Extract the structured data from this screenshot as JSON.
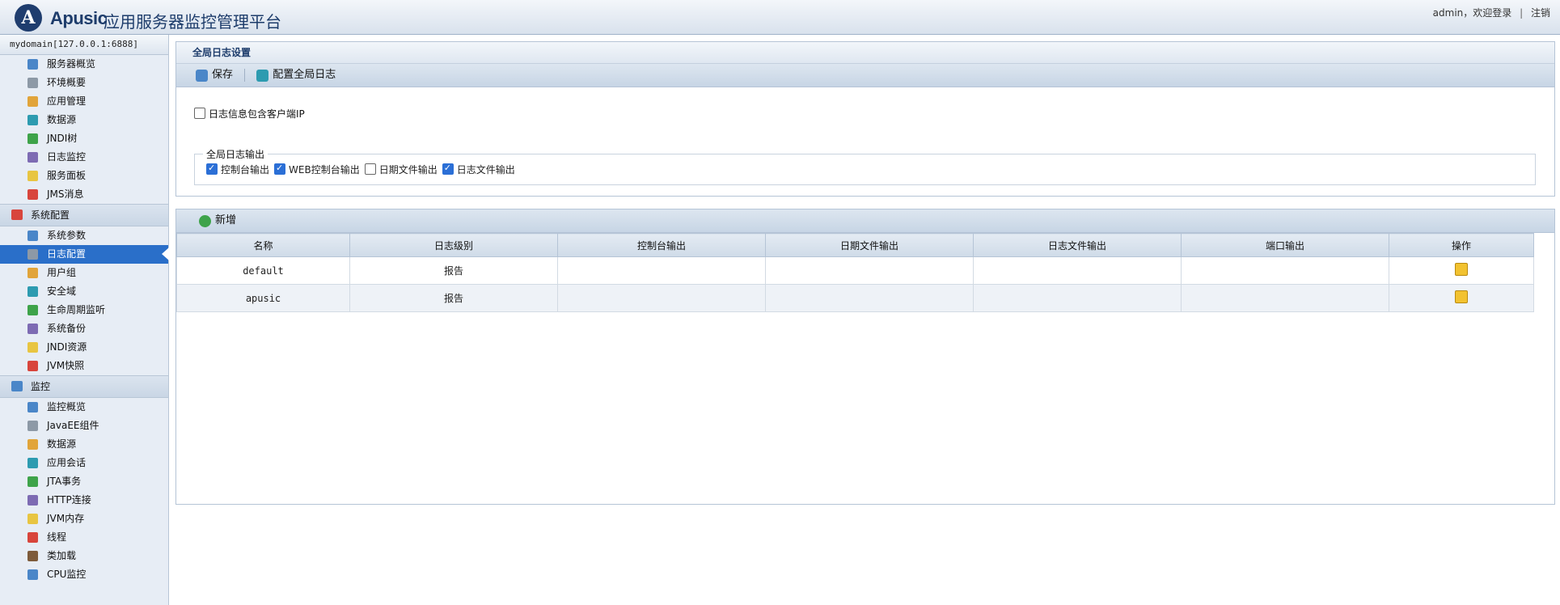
{
  "header": {
    "logo_letter": "A",
    "brand": "Apusic",
    "title": "应用服务器监控管理平台",
    "user_text": "admin，欢迎登录",
    "separator": "|",
    "logout": "注销"
  },
  "sidebar": {
    "domain": "mydomain[127.0.0.1:6888]",
    "overview_items": [
      {
        "label": "服务器概览",
        "icon": "server-overview-icon"
      },
      {
        "label": "环境概要",
        "icon": "environment-icon"
      },
      {
        "label": "应用管理",
        "icon": "application-icon"
      },
      {
        "label": "数据源",
        "icon": "database-icon"
      },
      {
        "label": "JNDI树",
        "icon": "jndi-tree-icon"
      },
      {
        "label": "日志监控",
        "icon": "monitor-icon"
      },
      {
        "label": "服务面板",
        "icon": "service-panel-icon"
      },
      {
        "label": "JMS消息",
        "icon": "jms-icon"
      }
    ],
    "config_section": "系统配置",
    "config_items": [
      {
        "label": "系统参数",
        "icon": "parameters-icon"
      },
      {
        "label": "日志配置",
        "icon": "log-config-icon",
        "active": true
      },
      {
        "label": "用户组",
        "icon": "users-icon"
      },
      {
        "label": "安全域",
        "icon": "security-icon"
      },
      {
        "label": "生命周期监听",
        "icon": "lifecycle-icon"
      },
      {
        "label": "系统备份",
        "icon": "backup-icon"
      },
      {
        "label": "JNDI资源",
        "icon": "jndi-resource-icon"
      },
      {
        "label": "JVM快照",
        "icon": "jvm-snapshot-icon"
      }
    ],
    "monitor_section": "监控",
    "monitor_items": [
      {
        "label": "监控概览",
        "icon": "chart-icon"
      },
      {
        "label": "JavaEE组件",
        "icon": "component-icon"
      },
      {
        "label": "数据源",
        "icon": "database-icon"
      },
      {
        "label": "应用会话",
        "icon": "session-icon"
      },
      {
        "label": "JTA事务",
        "icon": "transaction-icon"
      },
      {
        "label": "HTTP连接",
        "icon": "http-icon"
      },
      {
        "label": "JVM内存",
        "icon": "memory-icon"
      },
      {
        "label": "线程",
        "icon": "thread-icon"
      },
      {
        "label": "类加载",
        "icon": "classload-icon"
      },
      {
        "label": "CPU监控",
        "icon": "cpu-icon"
      }
    ]
  },
  "settings": {
    "title": "全局日志设置",
    "save": "保存",
    "configure": "配置全局日志",
    "include_ip_label": "日志信息包含客户端IP",
    "include_ip_checked": false,
    "output_legend": "全局日志输出",
    "outputs": [
      {
        "label": "控制台输出",
        "checked": true
      },
      {
        "label": "WEB控制台输出",
        "checked": true
      },
      {
        "label": "日期文件输出",
        "checked": false
      },
      {
        "label": "日志文件输出",
        "checked": true
      }
    ]
  },
  "loggers": {
    "add": "新增",
    "columns": [
      "名称",
      "日志级别",
      "控制台输出",
      "日期文件输出",
      "日志文件输出",
      "端口输出",
      "操作"
    ],
    "rows": [
      {
        "name": "default",
        "level": "报告",
        "console": "",
        "date_file": "",
        "log_file": "",
        "port": ""
      },
      {
        "name": "apusic",
        "level": "报告",
        "console": "",
        "date_file": "",
        "log_file": "",
        "port": ""
      }
    ]
  }
}
